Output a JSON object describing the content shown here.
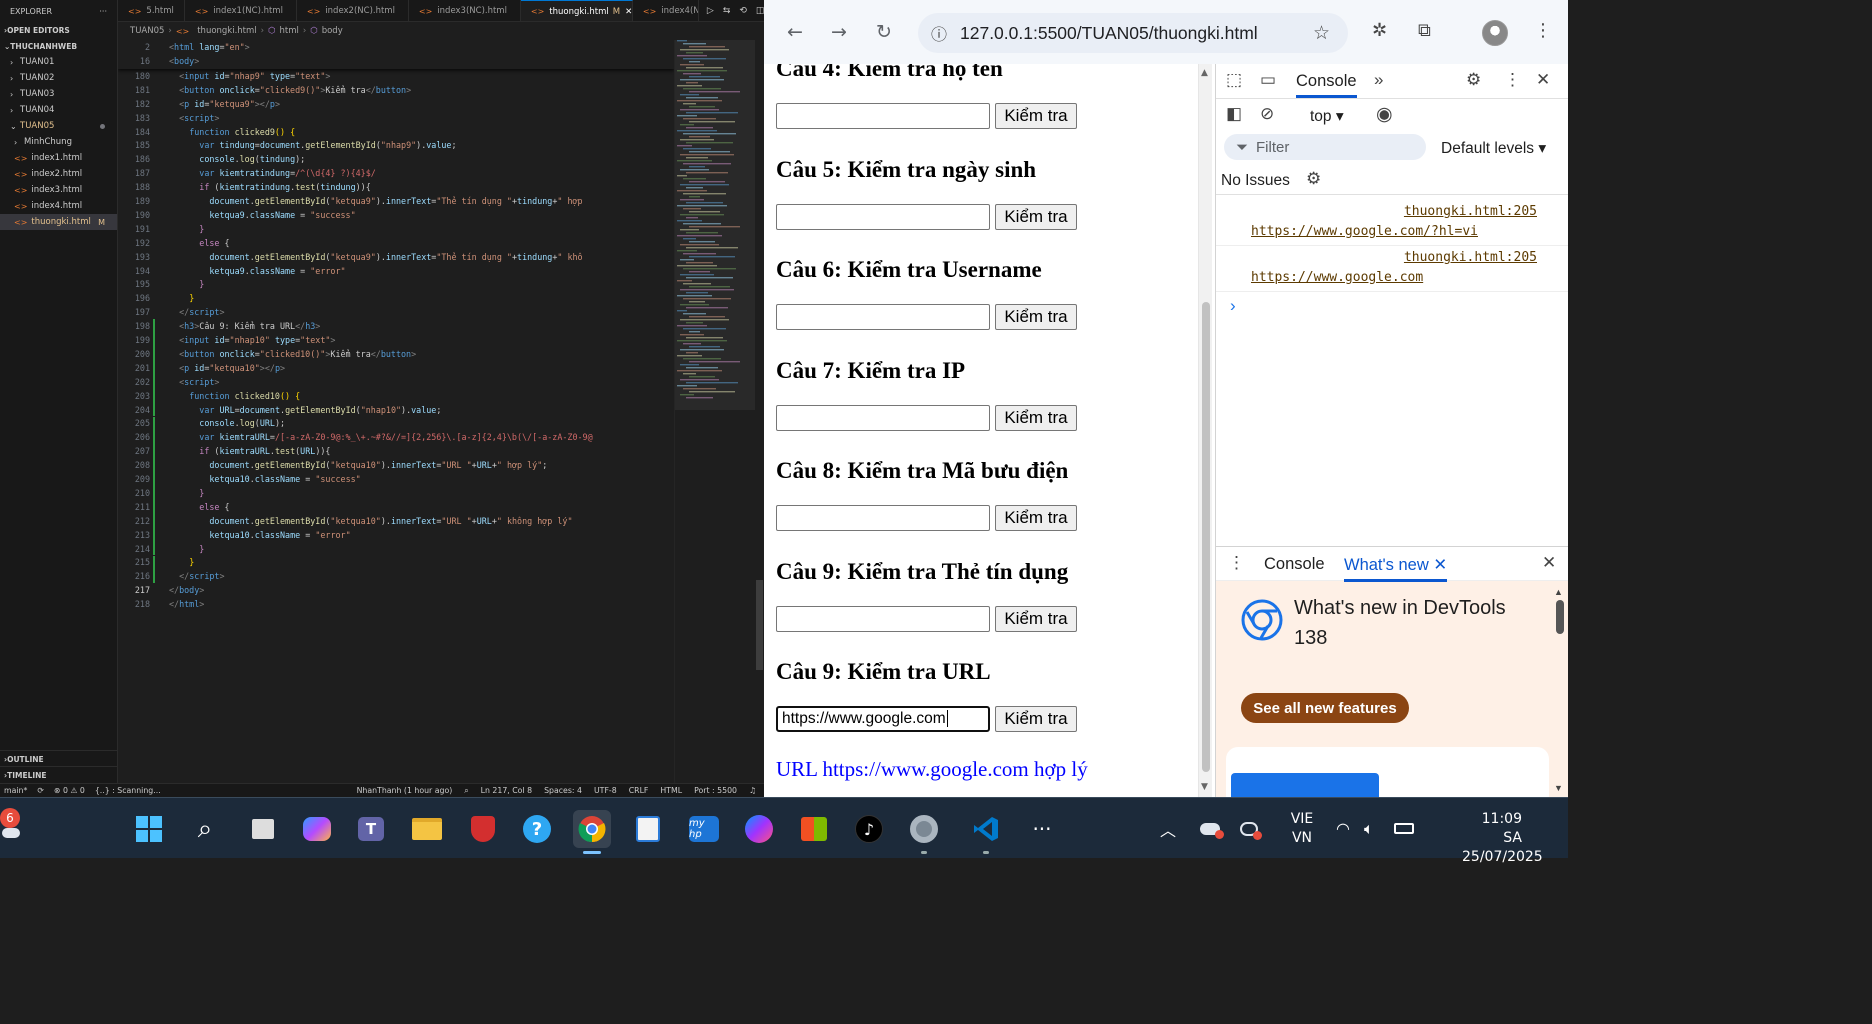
{
  "vscode": {
    "explorer_label": "EXPLORER",
    "open_editors": "OPEN EDITORS",
    "workspace": "THUCHANHWEB",
    "folders": [
      "TUAN01",
      "TUAN02",
      "TUAN03",
      "TUAN04"
    ],
    "open_folder": "TUAN05",
    "subfolder": "MinhChung",
    "files": [
      "index1.html",
      "index2.html",
      "index3.html",
      "index4.html"
    ],
    "selected_file": "thuongki.html",
    "modified_flag": "M",
    "outline": "OUTLINE",
    "timeline": "TIMELINE",
    "tabs": [
      "5.html",
      "index1(NC).html",
      "index2(NC).html",
      "index3(NC).html",
      "thuongki.html",
      "index4(N"
    ],
    "active_tab_flag": "M",
    "breadcrumb": [
      "TUAN05",
      "thuongki.html",
      "html",
      "body"
    ],
    "status": {
      "branch": "main*",
      "problems": "⊗ 0 ⚠ 0",
      "scanning": "{..} : Scanning...",
      "git_blame": "NhanThanh (1 hour ago)",
      "position": "Ln 217, Col 8",
      "spaces": "Spaces: 4",
      "encoding": "UTF-8",
      "eol": "CRLF",
      "language": "HTML",
      "port": "Port : 5500"
    },
    "sticky_lines": [
      {
        "n": "2",
        "html": "<span class='p'>&lt;</span><span class='t'>html</span> <span class='a'>lang</span><span class='pl'>=</span><span class='s'>\"en\"</span><span class='p'>&gt;</span>"
      },
      {
        "n": "16",
        "html": "<span class='p'>&lt;</span><span class='t'>body</span><span class='p'>&gt;</span>"
      }
    ],
    "code_lines": [
      {
        "n": "180",
        "i": 2,
        "html": "<span class='p'>&lt;</span><span class='t'>input</span> <span class='a'>id</span>=<span class='s'>\"nhap9\"</span> <span class='a'>type</span>=<span class='s'>\"text\"</span><span class='p'>&gt;</span>"
      },
      {
        "n": "181",
        "i": 2,
        "html": "<span class='p'>&lt;</span><span class='t'>button</span> <span class='a'>onclick</span>=<span class='s'>\"clicked9()\"</span><span class='p'>&gt;</span>Kiểm tra<span class='p'>&lt;/</span><span class='t'>button</span><span class='p'>&gt;</span>"
      },
      {
        "n": "182",
        "i": 2,
        "html": "<span class='p'>&lt;</span><span class='t'>p</span> <span class='a'>id</span>=<span class='s'>\"ketqua9\"</span><span class='p'>&gt;&lt;/</span><span class='t'>p</span><span class='p'>&gt;</span>"
      },
      {
        "n": "183",
        "i": 2,
        "html": "<span class='p'>&lt;</span><span class='t'>script</span><span class='p'>&gt;</span>"
      },
      {
        "n": "184",
        "i": 4,
        "html": "<span class='k'>function</span> <span class='f'>clicked9</span><span class='y'>()</span> <span class='y'>{</span>"
      },
      {
        "n": "185",
        "i": 6,
        "html": "<span class='k'>var</span> <span class='v'>tindung</span>=<span class='v'>document</span>.<span class='f'>getElementById</span>(<span class='s'>\"nhap9\"</span>).<span class='v'>value</span>;"
      },
      {
        "n": "186",
        "i": 6,
        "html": "<span class='v'>console</span>.<span class='f'>log</span>(<span class='v'>tindung</span>);"
      },
      {
        "n": "187",
        "i": 6,
        "html": "<span class='k'>var</span> <span class='v'>kiemtratindung</span>=<span class='r'>/^(\\d{4} ?){4}$/</span>"
      },
      {
        "n": "188",
        "i": 6,
        "html": "<span class='kw'>if</span> (<span class='v'>kiemtratindung</span>.<span class='f'>test</span>(<span class='v'>tindung</span>)){"
      },
      {
        "n": "189",
        "i": 8,
        "html": "<span class='v'>document</span>.<span class='f'>getElementById</span>(<span class='s'>\"ketqua9\"</span>).<span class='v'>innerText</span>=<span class='s'>\"Thẻ tín dụng \"</span>+<span class='v'>tindung</span>+<span class='s'>\" hợp</span>"
      },
      {
        "n": "190",
        "i": 8,
        "html": "<span class='v'>ketqua9</span>.<span class='v'>className</span> = <span class='s'>\"success\"</span>"
      },
      {
        "n": "191",
        "i": 6,
        "html": "<span class='kw'>}</span>"
      },
      {
        "n": "192",
        "i": 6,
        "html": "<span class='kw'>else</span> {"
      },
      {
        "n": "193",
        "i": 8,
        "html": "<span class='v'>document</span>.<span class='f'>getElementById</span>(<span class='s'>\"ketqua9\"</span>).<span class='v'>innerText</span>=<span class='s'>\"Thẻ tín dụng \"</span>+<span class='v'>tindung</span>+<span class='s'>\" khô</span>"
      },
      {
        "n": "194",
        "i": 8,
        "html": "<span class='v'>ketqua9</span>.<span class='v'>className</span> = <span class='s'>\"error\"</span>"
      },
      {
        "n": "195",
        "i": 6,
        "html": "<span class='kw'>}</span>"
      },
      {
        "n": "196",
        "i": 4,
        "html": "<span class='y'>}</span>"
      },
      {
        "n": "197",
        "i": 2,
        "html": "<span class='p'>&lt;/</span><span class='t'>script</span><span class='p'>&gt;</span>"
      },
      {
        "n": "198",
        "i": 2,
        "g": 1,
        "html": "<span class='p'>&lt;</span><span class='t'>h3</span><span class='p'>&gt;</span>Câu 9: Kiểm tra URL<span class='p'>&lt;/</span><span class='t'>h3</span><span class='p'>&gt;</span>"
      },
      {
        "n": "199",
        "i": 2,
        "g": 1,
        "html": "<span class='p'>&lt;</span><span class='t'>input</span> <span class='a'>id</span>=<span class='s'>\"nhap10\"</span> <span class='a'>type</span>=<span class='s'>\"text\"</span><span class='p'>&gt;</span>"
      },
      {
        "n": "200",
        "i": 2,
        "g": 1,
        "html": "<span class='p'>&lt;</span><span class='t'>button</span> <span class='a'>onclick</span>=<span class='s'>\"clicked10()\"</span><span class='p'>&gt;</span>Kiểm tra<span class='p'>&lt;/</span><span class='t'>button</span><span class='p'>&gt;</span>"
      },
      {
        "n": "201",
        "i": 2,
        "g": 1,
        "html": "<span class='p'>&lt;</span><span class='t'>p</span> <span class='a'>id</span>=<span class='s'>\"ketqua10\"</span><span class='p'>&gt;&lt;/</span><span class='t'>p</span><span class='p'>&gt;</span>"
      },
      {
        "n": "202",
        "i": 2,
        "g": 1,
        "html": "<span class='p'>&lt;</span><span class='t'>script</span><span class='p'>&gt;</span>"
      },
      {
        "n": "203",
        "i": 4,
        "g": 1,
        "html": "<span class='k'>function</span> <span class='f'>clicked10</span><span class='y'>()</span> <span class='y'>{</span>"
      },
      {
        "n": "204",
        "i": 6,
        "g": 1,
        "html": "<span class='k'>var</span> <span class='v'>URL</span>=<span class='v'>document</span>.<span class='f'>getElementById</span>(<span class='s'>\"nhap10\"</span>).<span class='v'>value</span>;"
      },
      {
        "n": "205",
        "i": 6,
        "g": 1,
        "html": "<span class='v'>console</span>.<span class='f'>log</span>(<span class='v'>URL</span>);"
      },
      {
        "n": "206",
        "i": 6,
        "g": 1,
        "html": "<span class='k'>var</span> <span class='v'>kiemtraURL</span>=<span class='r'>/[-a-zA-Z0-9@:%_\\+.~#?&amp;//=]{2,256}\\.[a-z]{2,4}\\b(\\/[-a-zA-Z0-9@</span>"
      },
      {
        "n": "207",
        "i": 6,
        "g": 1,
        "html": "<span class='kw'>if</span> (<span class='v'>kiemtraURL</span>.<span class='f'>test</span>(<span class='v'>URL</span>)){"
      },
      {
        "n": "208",
        "i": 8,
        "g": 1,
        "html": "<span class='v'>document</span>.<span class='f'>getElementById</span>(<span class='s'>\"ketqua10\"</span>).<span class='v'>innerText</span>=<span class='s'>\"URL \"</span>+<span class='v'>URL</span>+<span class='s'>\" hợp lý\"</span>;"
      },
      {
        "n": "209",
        "i": 8,
        "g": 1,
        "html": "<span class='v'>ketqua10</span>.<span class='v'>className</span> = <span class='s'>\"success\"</span>"
      },
      {
        "n": "210",
        "i": 6,
        "g": 1,
        "html": "<span class='kw'>}</span>"
      },
      {
        "n": "211",
        "i": 6,
        "g": 1,
        "html": "<span class='kw'>else</span> {"
      },
      {
        "n": "212",
        "i": 8,
        "g": 1,
        "html": "<span class='v'>document</span>.<span class='f'>getElementById</span>(<span class='s'>\"ketqua10\"</span>).<span class='v'>innerText</span>=<span class='s'>\"URL \"</span>+<span class='v'>URL</span>+<span class='s'>\" không hợp lý\"</span>"
      },
      {
        "n": "213",
        "i": 8,
        "g": 1,
        "html": "<span class='v'>ketqua10</span>.<span class='v'>className</span> = <span class='s'>\"error\"</span>"
      },
      {
        "n": "214",
        "i": 6,
        "g": 1,
        "html": "<span class='kw'>}</span>"
      },
      {
        "n": "215",
        "i": 4,
        "g": 1,
        "html": "<span class='y'>}</span>"
      },
      {
        "n": "216",
        "i": 2,
        "g": 1,
        "html": "<span class='p'>&lt;/</span><span class='t'>script</span><span class='p'>&gt;</span>"
      },
      {
        "n": "217",
        "i": 0,
        "cur": 1,
        "html": "<span class='p'>&lt;/</span><span class='t'>body</span><span class='p'>&gt;</span>"
      },
      {
        "n": "218",
        "i": 0,
        "html": "<span class='p'>&lt;/</span><span class='t'>html</span><span class='p'>&gt;</span>"
      }
    ]
  },
  "browser": {
    "url": "127.0.0.1:5500/TUAN05/thuongki.html",
    "questions": [
      {
        "title": "Câu 4: Kiểm tra họ tên",
        "value": ""
      },
      {
        "title": "Câu 5: Kiểm tra ngày sinh",
        "value": ""
      },
      {
        "title": "Câu 6: Kiểm tra Username",
        "value": ""
      },
      {
        "title": "Câu 7: Kiểm tra IP",
        "value": ""
      },
      {
        "title": "Câu 8: Kiểm tra Mã bưu điện",
        "value": ""
      },
      {
        "title": "Câu 9: Kiểm tra Thẻ tín dụng",
        "value": ""
      },
      {
        "title": "Câu 9: Kiểm tra URL",
        "value": "https://www.google.com"
      }
    ],
    "button_label": "Kiểm tra",
    "result_text": "URL https://www.google.com hợp lý",
    "result_color": "#0000ff"
  },
  "devtools": {
    "console_tab": "Console",
    "context": "top ▾",
    "filter_placeholder": "Filter",
    "levels": "Default levels ▾",
    "issues": "No Issues",
    "logs": [
      {
        "source": "thuongki.html:205",
        "message": "https://www.google.com/?hl=vi"
      },
      {
        "source": "thuongki.html:205",
        "message": "https://www.google.com"
      }
    ],
    "drawer_tabs": [
      "Console",
      "What's new"
    ],
    "whats_new_title": "What's new in DevTools 138",
    "whats_new_button": "See all new features",
    "accent": "#0b57d0"
  },
  "taskbar": {
    "weather_badge": "6",
    "lang_top": "VIE",
    "lang_bottom": "VN",
    "time": "11:09 SA",
    "date": "25/07/2025"
  }
}
